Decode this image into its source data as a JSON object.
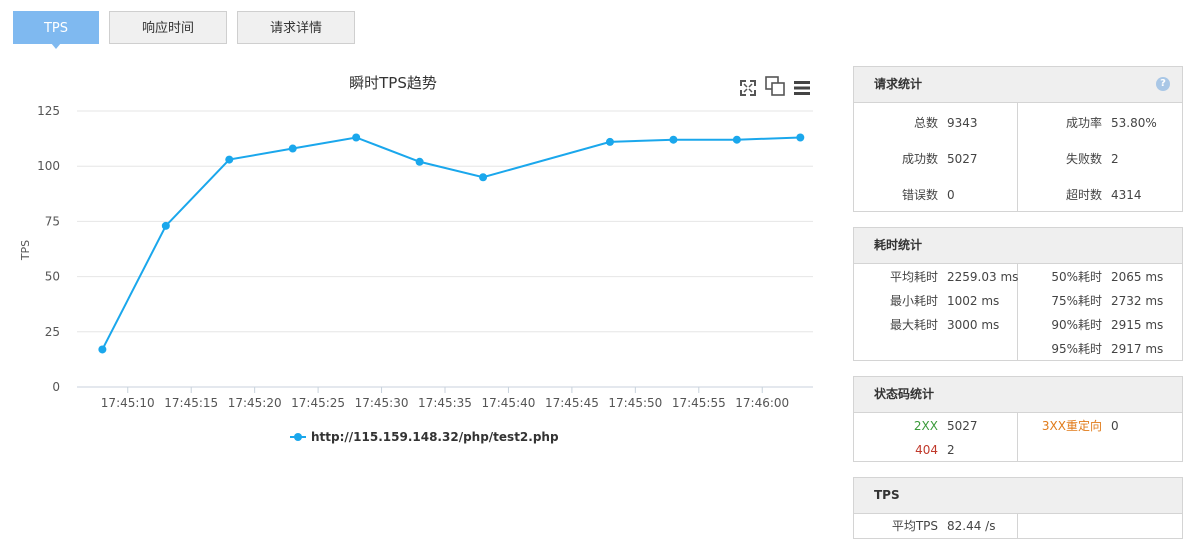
{
  "tabs": [
    {
      "label": "TPS",
      "active": true
    },
    {
      "label": "响应时间",
      "active": false
    },
    {
      "label": "请求详情",
      "active": false
    }
  ],
  "toolbar_icons": [
    "fullscreen-icon",
    "restore-icon",
    "menu-icon"
  ],
  "chart_data": {
    "type": "line",
    "title": "瞬时TPS趋势",
    "ylabel": "TPS",
    "ylim": [
      0,
      125
    ],
    "yticks": [
      "125",
      "100",
      "75",
      "50",
      "25",
      "0"
    ],
    "xticks": [
      "17:45:10",
      "17:45:15",
      "17:45:20",
      "17:45:25",
      "17:45:30",
      "17:45:35",
      "17:45:40",
      "17:45:45",
      "17:45:50",
      "17:45:55",
      "17:46:00"
    ],
    "grid": true,
    "legend_position": "bottom",
    "series": [
      {
        "name": "http://115.159.148.32/php/test2.php",
        "color": "#1aa7ec",
        "x": [
          "17:45:08",
          "17:45:13",
          "17:45:18",
          "17:45:23",
          "17:45:28",
          "17:45:33",
          "17:45:38",
          "17:45:48",
          "17:45:53",
          "17:45:58",
          "17:46:03"
        ],
        "values": [
          17,
          73,
          103,
          108,
          113,
          102,
          95,
          111,
          112,
          112,
          113
        ]
      }
    ]
  },
  "panels": {
    "request": {
      "title": "请求统计",
      "help": "?",
      "rows": [
        {
          "label": "总数",
          "value": "9343",
          "label2": "成功率",
          "value2": "53.80%"
        },
        {
          "label": "成功数",
          "value": "5027",
          "label2": "失败数",
          "value2": "2"
        },
        {
          "label": "错误数",
          "value": "0",
          "label2": "超时数",
          "value2": "4314"
        }
      ]
    },
    "time": {
      "title": "耗时统计",
      "left": [
        {
          "label": "平均耗时",
          "value": "2259.03 ms"
        },
        {
          "label": "最小耗时",
          "value": "1002 ms"
        },
        {
          "label": "最大耗时",
          "value": "3000 ms"
        }
      ],
      "right": [
        {
          "label": "50%耗时",
          "value": "2065 ms"
        },
        {
          "label": "75%耗时",
          "value": "2732 ms"
        },
        {
          "label": "90%耗时",
          "value": "2915 ms"
        },
        {
          "label": "95%耗时",
          "value": "2917 ms"
        }
      ]
    },
    "status": {
      "title": "状态码统计",
      "rows": [
        {
          "label": "2XX",
          "value": "5027",
          "color": "#3a9a3a",
          "label2": "3XX重定向",
          "value2": "0",
          "color2": "#e07b1a"
        },
        {
          "label": "404",
          "value": "2",
          "color": "#c0392b"
        }
      ]
    },
    "tps": {
      "title": "TPS",
      "rows": [
        {
          "label": "平均TPS",
          "value": "82.44 /s"
        }
      ]
    }
  }
}
